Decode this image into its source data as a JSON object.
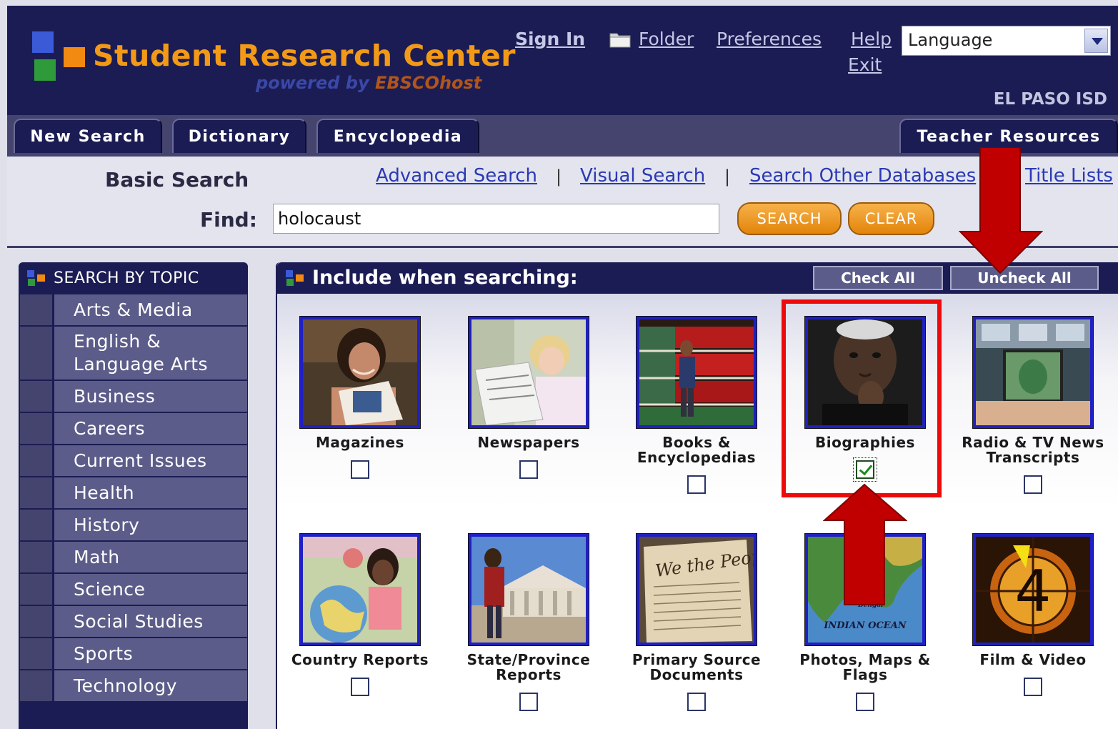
{
  "header": {
    "logo_title": "Student Research Center",
    "logo_powered": "powered by ",
    "logo_brand": "EBSCOhost",
    "links": {
      "sign_in": "Sign In",
      "folder": "Folder",
      "preferences": "Preferences",
      "help": "Help",
      "exit": "Exit"
    },
    "language_select": "Language",
    "org": "EL PASO ISD",
    "colors": {
      "background": "#1c1c54",
      "logo": "#f29a17"
    }
  },
  "nav": {
    "new_search": "New Search",
    "dictionary": "Dictionary",
    "encyclopedia": "Encyclopedia",
    "teacher_resources": "Teacher Resources"
  },
  "search": {
    "title": "Basic Search",
    "advanced": "Advanced Search",
    "visual": "Visual Search",
    "other_db": "Search Other Databases",
    "title_lists": "Title Lists",
    "separator": "|",
    "find_label": "Find:",
    "find_value": "holocaust",
    "search_btn": "SEARCH",
    "clear_btn": "CLEAR"
  },
  "sidebar": {
    "title": "SEARCH BY TOPIC",
    "items": [
      "Arts & Media",
      "English & Language Arts",
      "Business",
      "Careers",
      "Current Issues",
      "Health",
      "History",
      "Math",
      "Science",
      "Social Studies",
      "Sports",
      "Technology"
    ]
  },
  "panel": {
    "title": "Include when searching:",
    "check_all": "Check All",
    "uncheck_all": "Uncheck All",
    "sources": [
      {
        "label": "Magazines",
        "checked": false,
        "icon": "magazine-reader-photo"
      },
      {
        "label": "Newspapers",
        "checked": false,
        "icon": "newspaper-reader-photo"
      },
      {
        "label": "Books & Encyclopedias",
        "checked": false,
        "icon": "library-shelves-photo"
      },
      {
        "label": "Biographies",
        "checked": true,
        "icon": "portrait-photo"
      },
      {
        "label": "Radio & TV News Transcripts",
        "checked": false,
        "icon": "tv-studio-photo"
      },
      {
        "label": "Country Reports",
        "checked": false,
        "icon": "globe-student-photo"
      },
      {
        "label": "State/Province Reports",
        "checked": false,
        "icon": "capitol-building-photo"
      },
      {
        "label": "Primary Source Documents",
        "checked": false,
        "icon": "historic-document-photo"
      },
      {
        "label": "Photos, Maps & Flags",
        "checked": false,
        "icon": "map-photo"
      },
      {
        "label": "Film & Video",
        "checked": false,
        "icon": "film-countdown-photo"
      }
    ],
    "map_labels": {
      "bengal": "Bengal",
      "ocean": "INDIAN OCEAN"
    },
    "film_digit": "4",
    "document_script": "We the People"
  },
  "annotations": {
    "highlight_color": "#ee0a0a",
    "arrow_color": "#c00000"
  }
}
